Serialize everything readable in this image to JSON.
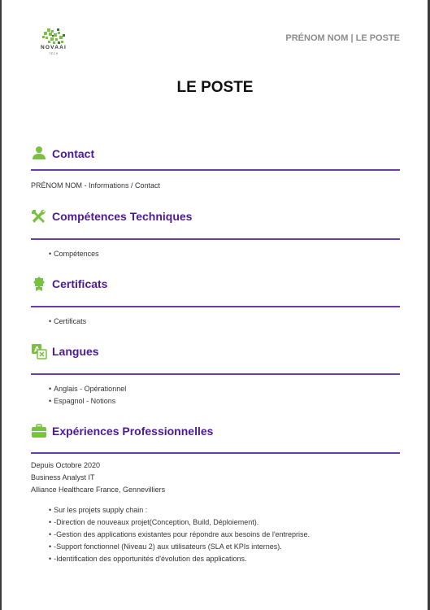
{
  "header": {
    "logo_name": "NOVAAI",
    "logo_sub": "TECH",
    "top_right": "PRÉNOM NOM | LE POSTE"
  },
  "title": "LE POSTE",
  "colors": {
    "accent": "#4b1b96",
    "rule": "#6a3cae",
    "icon": "#7ac142"
  },
  "sections": {
    "contact": {
      "icon": "person-icon",
      "title": "Contact",
      "text": "PRÉNOM NOM - Informations / Contact"
    },
    "skills": {
      "icon": "tools-icon",
      "title": "Compétences Techniques",
      "items": [
        "Compétences"
      ]
    },
    "certs": {
      "icon": "award-icon",
      "title": "Certificats",
      "items": [
        "Certificats"
      ]
    },
    "languages": {
      "icon": "translate-icon",
      "title": "Langues",
      "items": [
        "Anglais - Opérationnel",
        "Espagnol - Notions"
      ]
    },
    "experience": {
      "icon": "briefcase-icon",
      "title": "Expériences Professionnelles",
      "date": "Depuis Octobre 2020",
      "role": "Business Analyst IT",
      "company": "Alliance Healthcare France, Gennevilliers",
      "items": [
        "Sur les projets supply chain :",
        "-Direction de nouveaux projet(Conception, Build, Déploiement).",
        "-Gestion des applications existantes pour répondre aux besoins de l'entreprise.",
        "-Support fonctionnel (Niveau 2) aux utilisateurs (SLA et KPIs internes).",
        "-Identification des opportunités d'évolution des applications."
      ]
    }
  }
}
